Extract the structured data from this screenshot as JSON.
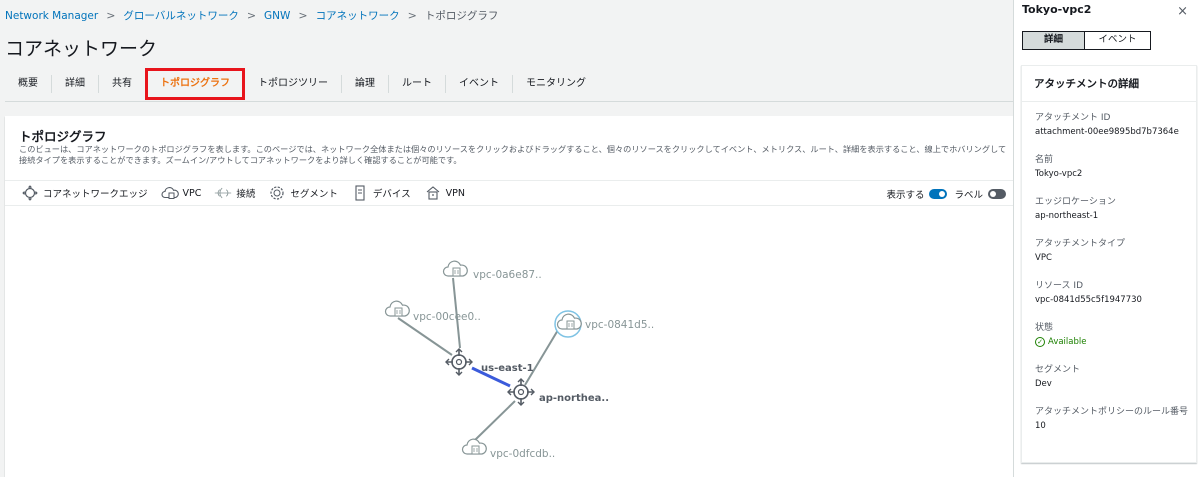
{
  "breadcrumb": [
    "Network Manager",
    "グローバルネットワーク",
    "GNW",
    "コアネットワーク",
    "トポロジグラフ"
  ],
  "page_title": "コアネットワーク",
  "tabs": [
    {
      "label": "概要",
      "active": false
    },
    {
      "label": "詳細",
      "active": false
    },
    {
      "label": "共有",
      "active": false
    },
    {
      "label": "トポロジグラフ",
      "active": true
    },
    {
      "label": "トポロジツリー",
      "active": false
    },
    {
      "label": "論理",
      "active": false
    },
    {
      "label": "ルート",
      "active": false
    },
    {
      "label": "イベント",
      "active": false
    },
    {
      "label": "モニタリング",
      "active": false
    }
  ],
  "panel": {
    "title": "トポロジグラフ",
    "description": "このビューは、コアネットワークのトポロジグラフを表します。このページでは、ネットワーク全体または個々のリソースをクリックおよびドラッグすること、個々のリソースをクリックしてイベント、メトリクス、ルート、詳細を表示すること、線上でホバリングして接続タイプを表示することができます。ズームイン/アウトしてコアネットワークをより詳しく確認することが可能です。"
  },
  "legend": [
    {
      "label": "コアネットワークエッジ",
      "icon": "core-edge-icon"
    },
    {
      "label": "VPC",
      "icon": "vpc-cloud-icon"
    },
    {
      "label": "接続",
      "icon": "connection-icon"
    },
    {
      "label": "セグメント",
      "icon": "segment-icon"
    },
    {
      "label": "デバイス",
      "icon": "device-icon"
    },
    {
      "label": "VPN",
      "icon": "vpn-icon"
    }
  ],
  "toggles": {
    "show_label": "表示する",
    "label_label": "ラベル"
  },
  "graph": {
    "edges": [
      "us-east-1",
      "ap-northea.."
    ],
    "vpcs": [
      "vpc-0a6e87..",
      "vpc-00cee0..",
      "vpc-0841d5..",
      "vpc-0dfcdb.."
    ]
  },
  "side": {
    "title": "Tokyo-vpc2",
    "close": "×",
    "seg_details": "詳細",
    "seg_events": "イベント",
    "details_title": "アタッチメントの詳細",
    "fields": [
      {
        "label": "アタッチメント ID",
        "value": "attachment-00ee9895bd7b7364e"
      },
      {
        "label": "名前",
        "value": "Tokyo-vpc2"
      },
      {
        "label": "エッジロケーション",
        "value": "ap-northeast-1"
      },
      {
        "label": "アタッチメントタイプ",
        "value": "VPC"
      },
      {
        "label": "リソース ID",
        "value": "vpc-0841d55c5f1947730"
      },
      {
        "label": "状態",
        "value": "Available"
      },
      {
        "label": "セグメント",
        "value": "Dev"
      },
      {
        "label": "アタッチメントポリシーのルール番号",
        "value": "10"
      }
    ]
  },
  "colors": {
    "link": "#0073bb",
    "active_tab": "#ec7211",
    "highlight": "#e8141b",
    "segment_line": "#3b5bdb",
    "available": "#1d8102"
  }
}
